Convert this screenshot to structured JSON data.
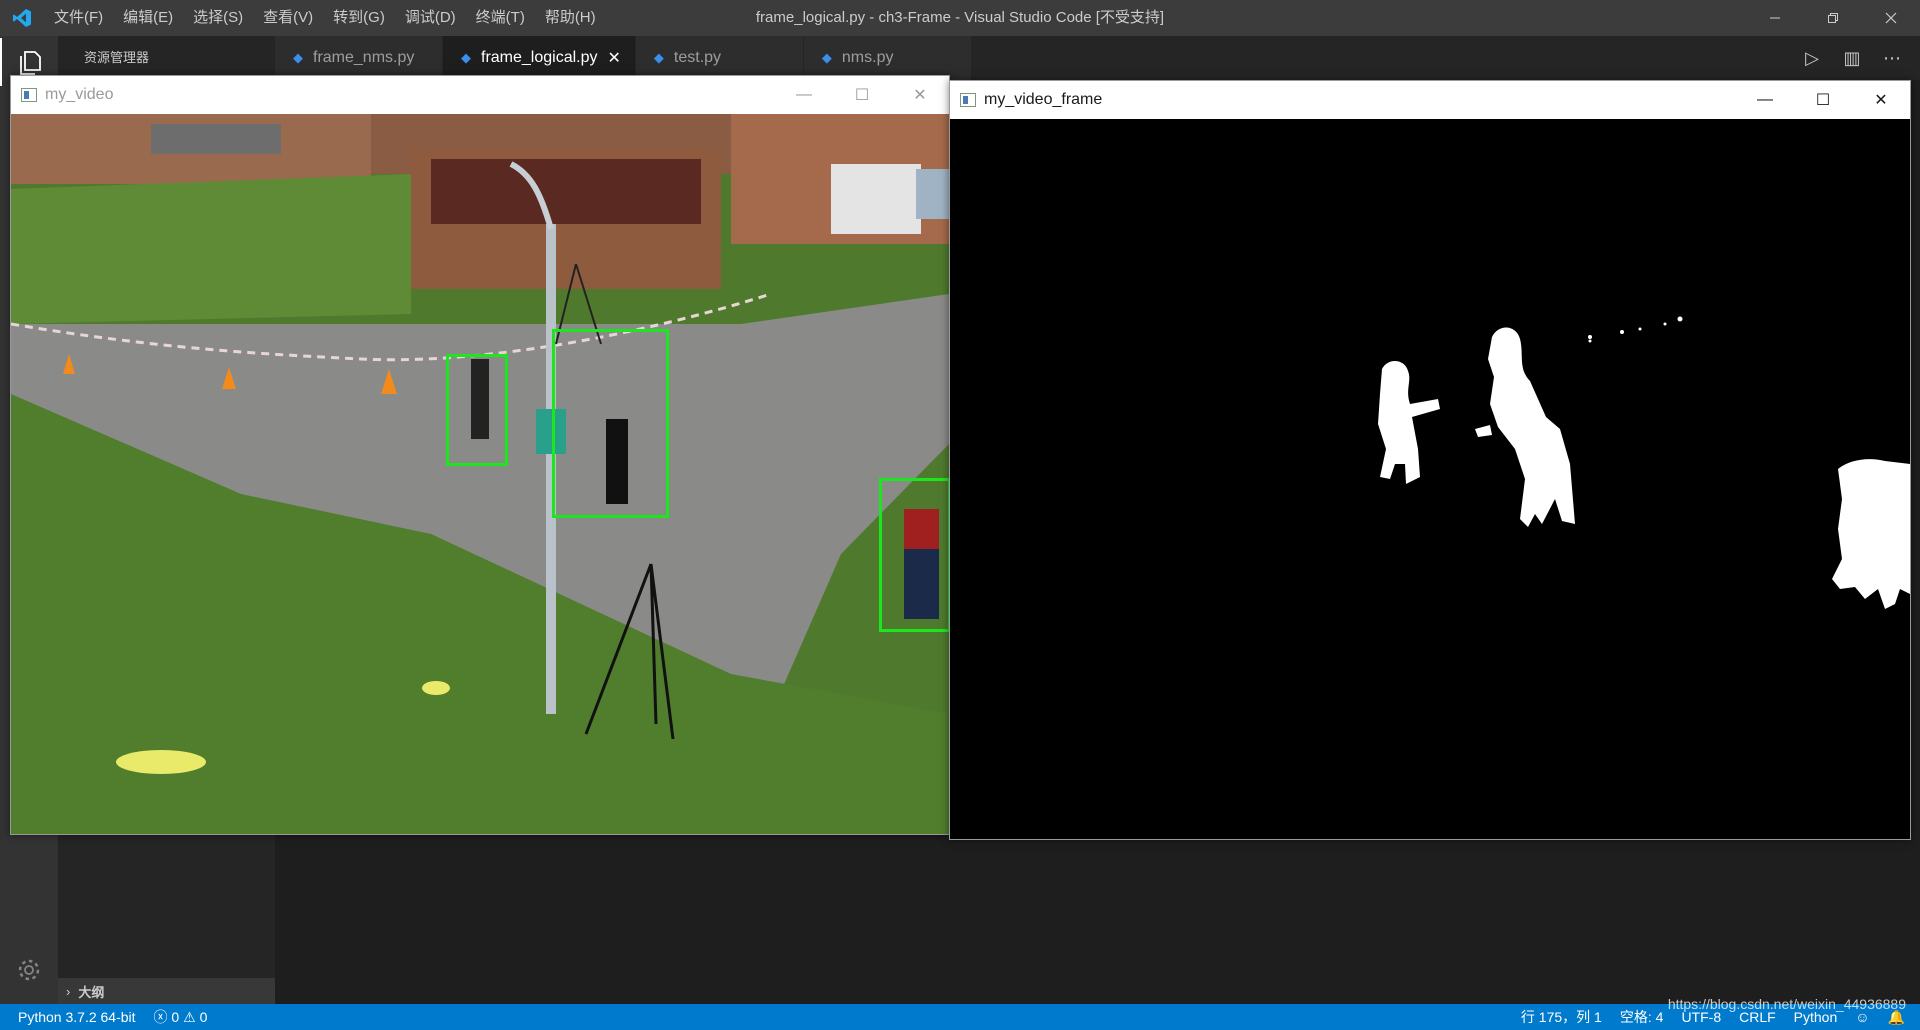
{
  "titlebar": {
    "menu": [
      "文件(F)",
      "编辑(E)",
      "选择(S)",
      "查看(V)",
      "转到(G)",
      "调试(D)",
      "终端(T)",
      "帮助(H)"
    ],
    "window_title": "frame_logical.py - ch3-Frame - Visual Studio Code [不受支持]"
  },
  "sidebar": {
    "title": "资源管理器",
    "outline_label": "大纲"
  },
  "tabs": [
    {
      "label": "frame_nms.py",
      "active": false
    },
    {
      "label": "frame_logical.py",
      "active": true
    },
    {
      "label": "test.py",
      "active": false
    },
    {
      "label": "nms.py",
      "active": false
    }
  ],
  "video_window": {
    "title": "my_video"
  },
  "frame_window": {
    "title": "my_video_frame"
  },
  "statusbar": {
    "python": "Python 3.7.2 64-bit",
    "errors": "0",
    "warnings": "0",
    "position": "行 175，列 1",
    "spaces": "空格: 4",
    "encoding": "UTF-8",
    "eol": "CRLF",
    "language": "Python",
    "watermark": "https://blog.csdn.net/weixin_44936889"
  },
  "colors": {
    "statusbar": "#007acc",
    "titlebar": "#3c3c3c",
    "activity": "#333333",
    "sidebar": "#252526",
    "editor": "#1e1e1e",
    "bbox": "#1ee61e"
  },
  "icons": [
    "vscode-logo-icon",
    "explorer-icon",
    "settings-gear-icon",
    "run-icon",
    "split-editor-icon",
    "more-actions-icon",
    "minimize-icon",
    "maximize-icon",
    "restore-icon",
    "close-icon",
    "error-icon",
    "warning-icon",
    "feedback-icon",
    "bell-icon",
    "python-file-icon",
    "chevron-right-icon"
  ]
}
